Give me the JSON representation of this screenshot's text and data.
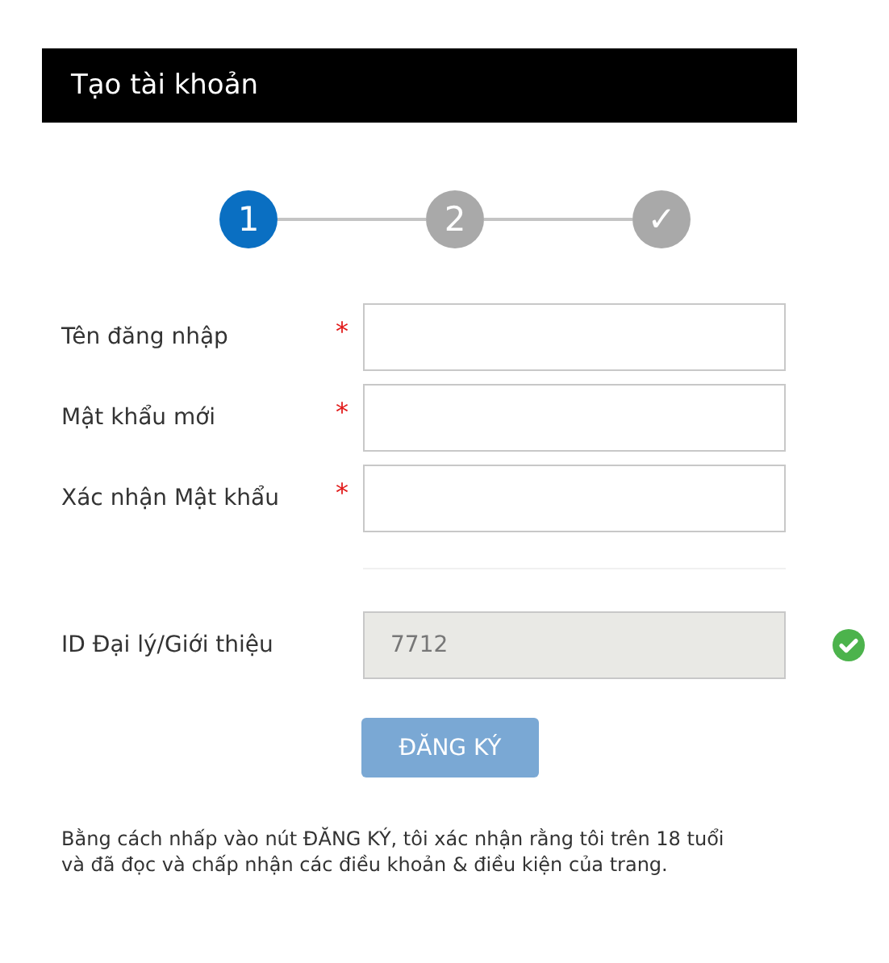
{
  "header": {
    "title": "Tạo tài khoản"
  },
  "steps": [
    {
      "label": "1",
      "selected": true
    },
    {
      "label": "2",
      "selected": false
    },
    {
      "label": "✓",
      "selected": false
    }
  ],
  "fields": [
    {
      "label": "Tên đăng nhập",
      "required": true,
      "disabled": false,
      "valid": false
    },
    {
      "label": "Mật khẩu mới",
      "required": true,
      "disabled": false,
      "valid": false
    },
    {
      "label": "Xác nhận Mật khẩu",
      "required": true,
      "disabled": false,
      "valid": false
    },
    {
      "label": "ID Đại lý/Giới thiệu",
      "required": false,
      "value": "7712",
      "disabled": true,
      "valid": true
    }
  ],
  "required_mark": "*",
  "submit": {
    "label": "ĐĂNG KÝ",
    "disabled": true
  },
  "note": "Bằng cách nhấp vào nút ĐĂNG KÝ, tôi xác nhận rằng tôi trên 18 tuổi và đã đọc và chấp nhận các điều khoản & điều kiện của trang."
}
